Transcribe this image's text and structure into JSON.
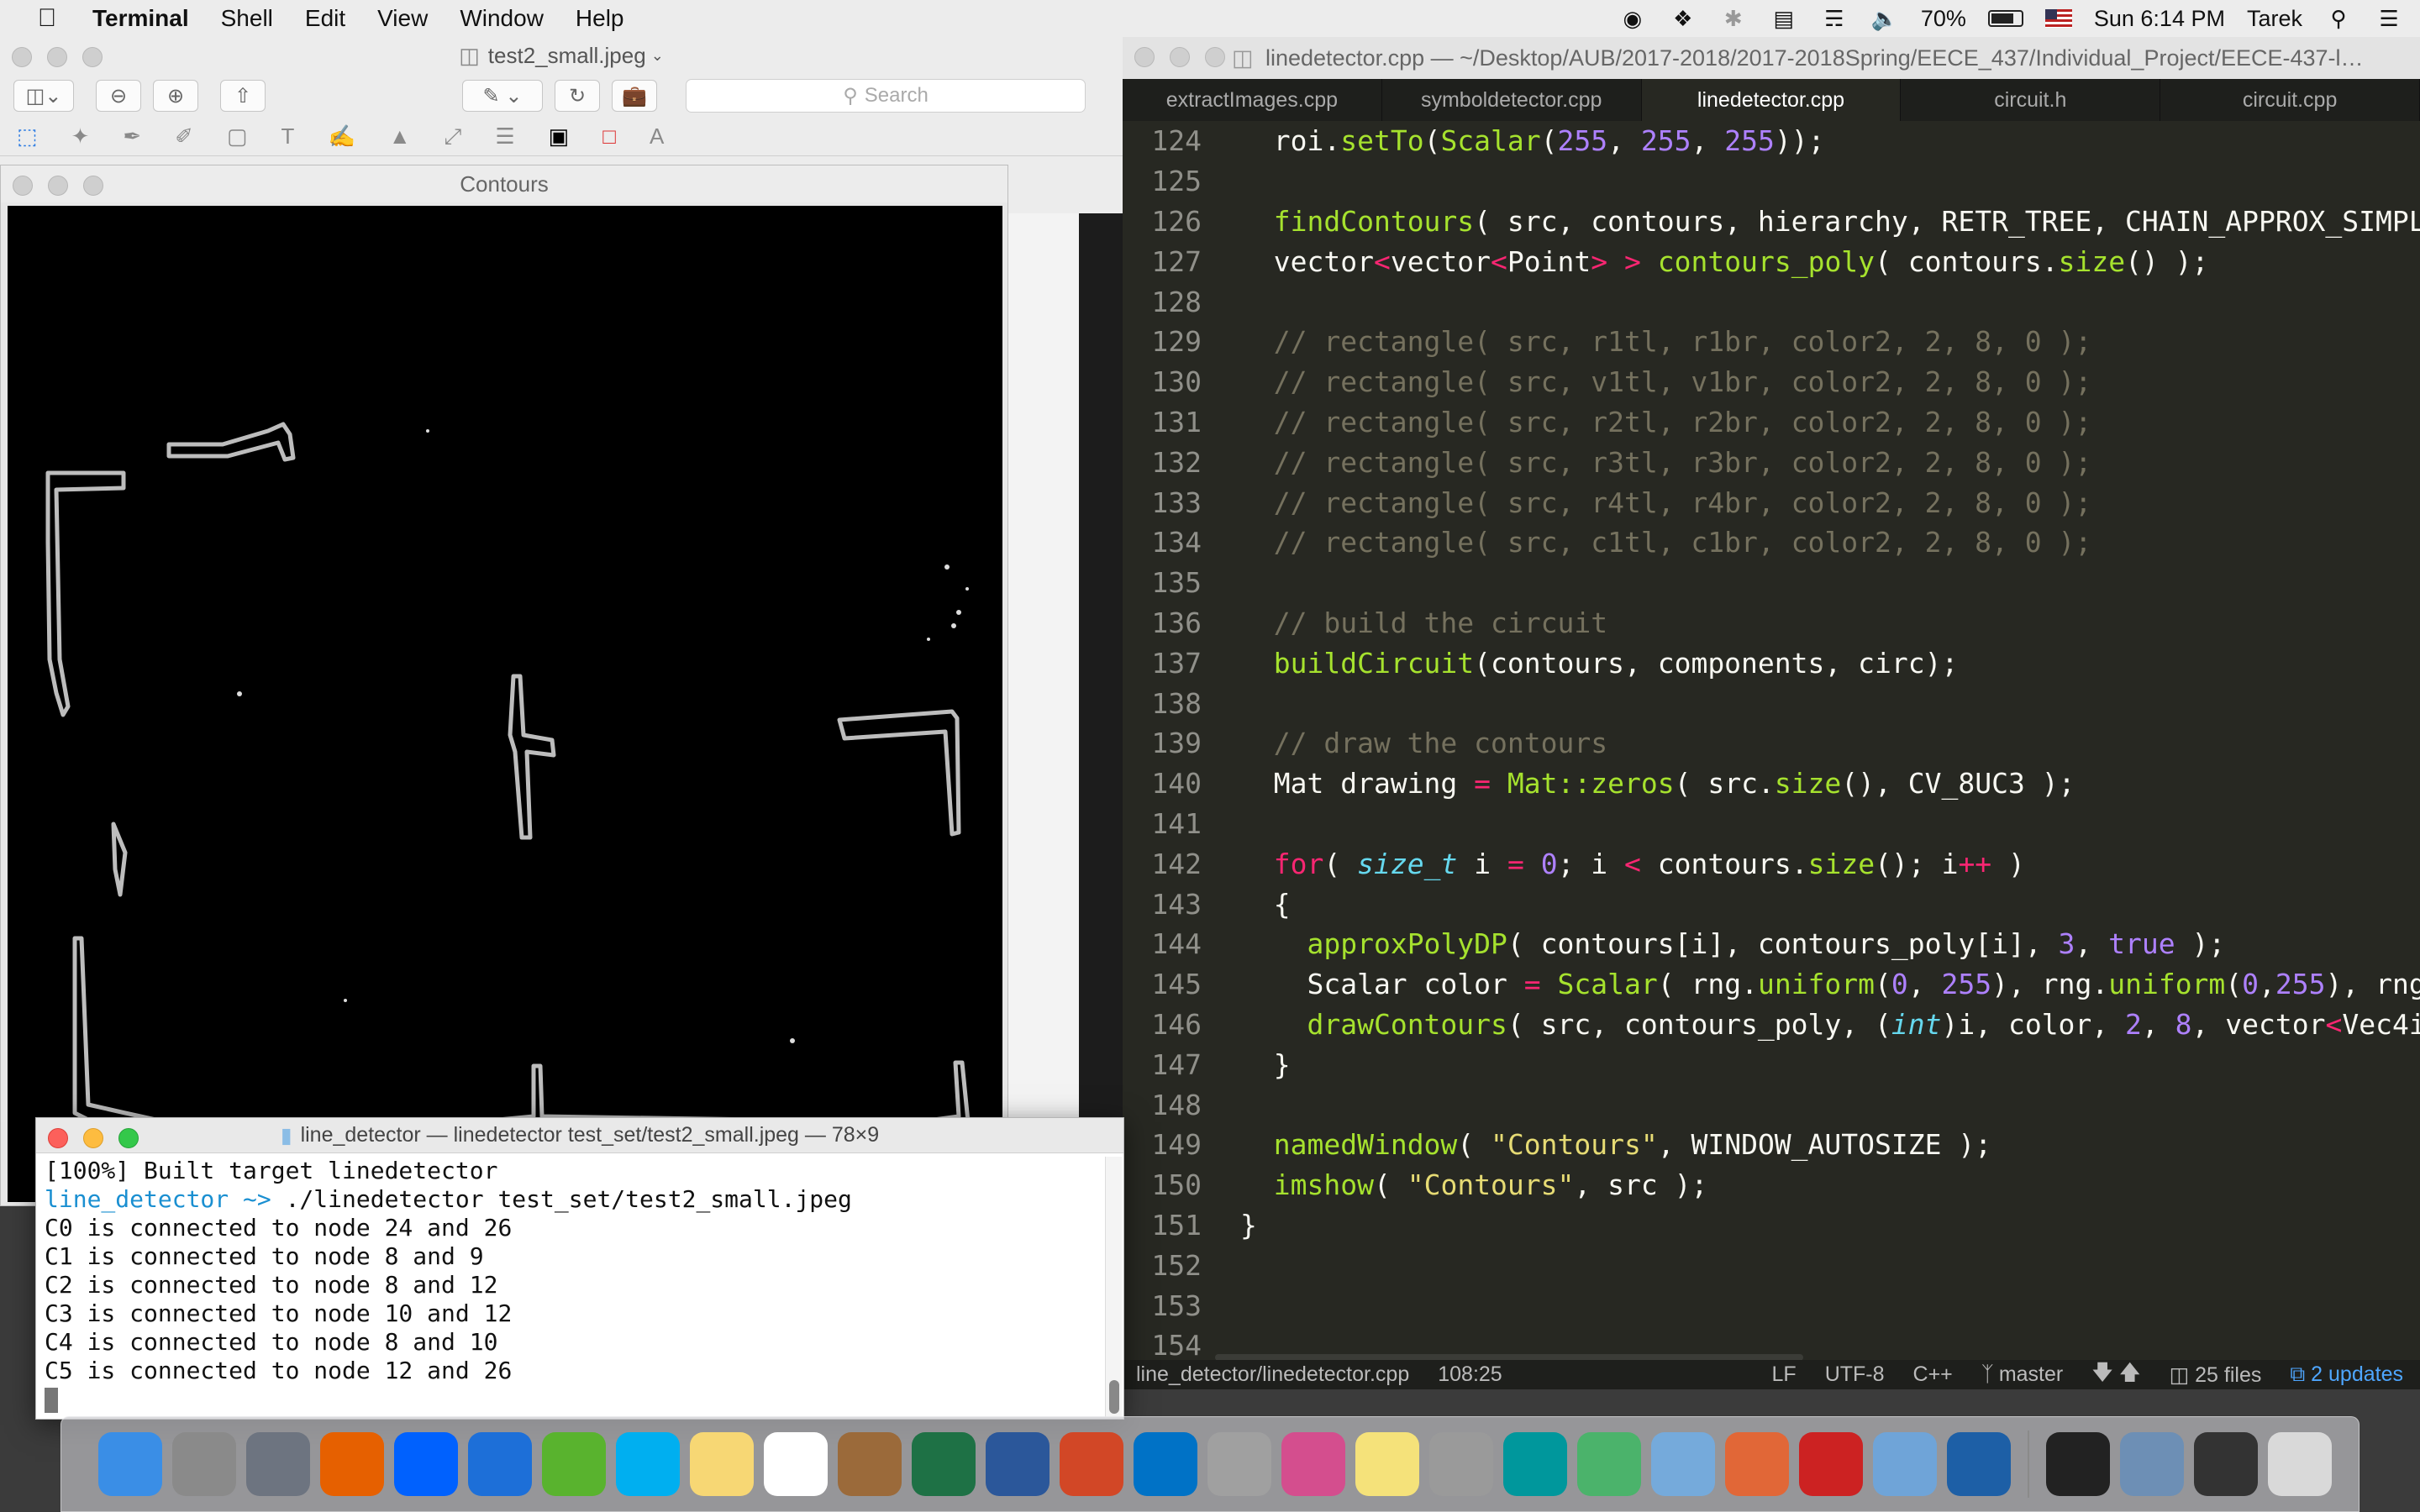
{
  "menubar": {
    "apple": "",
    "app": "Terminal",
    "items": [
      "Shell",
      "Edit",
      "View",
      "Window",
      "Help"
    ],
    "battery": "70%",
    "clock": "Sun 6:14 PM",
    "user": "Tarek"
  },
  "preview": {
    "title": "test2_small.jpeg",
    "search_placeholder": "Search"
  },
  "contours": {
    "title": "Contours"
  },
  "editor": {
    "title": "linedetector.cpp — ~/Desktop/AUB/2017-2018/2017-2018Spring/EECE_437/Individual_Project/EECE-437-l…",
    "tabs": [
      "extractImages.cpp",
      "symboldetector.cpp",
      "linedetector.cpp",
      "circuit.h",
      "circuit.cpp"
    ],
    "active_tab": 2,
    "line_numbers": [
      "124",
      "125",
      "126",
      "127",
      "128",
      "129",
      "130",
      "131",
      "132",
      "133",
      "134",
      "135",
      "136",
      "137",
      "138",
      "139",
      "140",
      "141",
      "142",
      "143",
      "144",
      "145",
      "146",
      "147",
      "148",
      "149",
      "150",
      "151",
      "152",
      "153",
      "154"
    ],
    "status": {
      "file": "line_detector/linedetector.cpp",
      "position": "108:25",
      "line_ending": "LF",
      "encoding": "UTF-8",
      "syntax": "C++",
      "branch": "master",
      "files": "25 files",
      "updates": "2 updates"
    }
  },
  "terminal": {
    "title": "line_detector — linedetector test_set/test2_small.jpeg — 78×9",
    "lines": [
      "[100%] Built target linedetector",
      "C0 is connected to node 24 and 26",
      "C1 is connected to node 8 and 9",
      "C2 is connected to node 8 and 12",
      "C3 is connected to node 10 and 12",
      "C4 is connected to node 8 and 10",
      "C5 is connected to node 12 and 26"
    ],
    "prompt": "line_detector ~>",
    "command": " ./linedetector test_set/test2_small.jpeg"
  },
  "dock": {
    "apps": [
      {
        "name": "finder",
        "color": "#3a8ee6"
      },
      {
        "name": "system-preferences",
        "color": "#8a8a8a"
      },
      {
        "name": "launchpad",
        "color": "#6d7480"
      },
      {
        "name": "firefox",
        "color": "#e66000"
      },
      {
        "name": "dropbox",
        "color": "#0061fe"
      },
      {
        "name": "youtube",
        "color": "#1d6fd8"
      },
      {
        "name": "utorrent",
        "color": "#59b32e"
      },
      {
        "name": "skype",
        "color": "#00aff0"
      },
      {
        "name": "notes",
        "color": "#f7d774"
      },
      {
        "name": "calendar",
        "color": "#ffffff"
      },
      {
        "name": "garageband",
        "color": "#9b6a3a"
      },
      {
        "name": "excel",
        "color": "#1e7145"
      },
      {
        "name": "word",
        "color": "#2b579a"
      },
      {
        "name": "powerpoint",
        "color": "#d24726"
      },
      {
        "name": "outlook",
        "color": "#0072c6"
      },
      {
        "name": "calculator",
        "color": "#a0a0a0"
      },
      {
        "name": "grapher",
        "color": "#d44e8e"
      },
      {
        "name": "stickies",
        "color": "#f5e27a"
      },
      {
        "name": "tex",
        "color": "#9a9a9a"
      },
      {
        "name": "arduino",
        "color": "#00979c"
      },
      {
        "name": "atom",
        "color": "#4bb36b"
      },
      {
        "name": "rstudio",
        "color": "#75aadb"
      },
      {
        "name": "matlab",
        "color": "#e16737"
      },
      {
        "name": "kivy",
        "color": "#c22"
      },
      {
        "name": "preview",
        "color": "#6fa4d8"
      },
      {
        "name": "virtualbox",
        "color": "#1d5fa6"
      },
      {
        "name": "terminal",
        "color": "#222"
      },
      {
        "name": "photos-viewer",
        "color": "#6d8fb5"
      },
      {
        "name": "console",
        "color": "#333"
      },
      {
        "name": "trash",
        "color": "#d9d9d9"
      }
    ]
  }
}
